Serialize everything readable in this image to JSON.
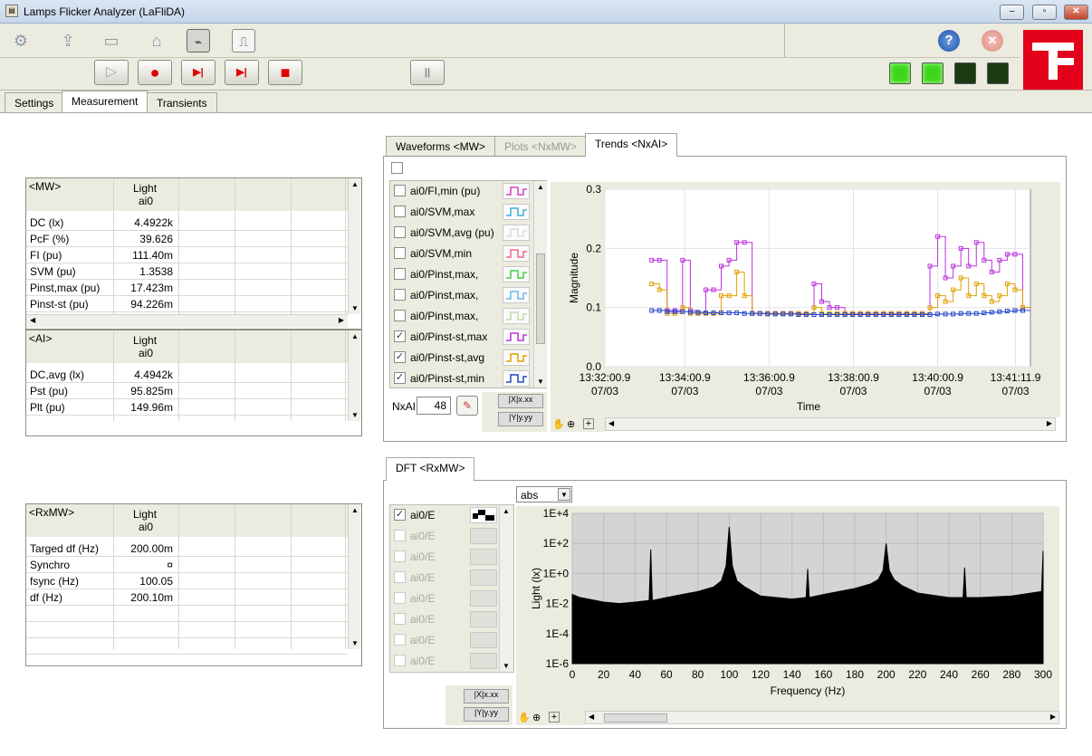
{
  "window": {
    "title": "Lamps Flicker Analyzer (LaFliDA)",
    "minimize": "‒",
    "maximize": "▫",
    "close": "✕"
  },
  "toolbar": {
    "icons": [
      "gear-icon",
      "export-icon",
      "folder-icon",
      "home-icon",
      "monitor-icon",
      "chart-icon"
    ],
    "help": "?",
    "stop": "✕",
    "controls": {
      "play": "▷",
      "record": "●",
      "step": "▶|",
      "step_one": "▶|",
      "stop": "■",
      "pause": "||"
    },
    "leds": [
      "#3ed61b",
      "#3ed61b",
      "#1c3a12",
      "#1c3a12"
    ]
  },
  "main_tabs": [
    "Settings",
    "Measurement",
    "Transients"
  ],
  "mw_table": {
    "title": "<MW>",
    "col_header": "Light",
    "col_sub": "ai0",
    "rows": [
      {
        "k": "DC (lx)",
        "v": "4.4922k"
      },
      {
        "k": "PcF (%)",
        "v": "39.626"
      },
      {
        "k": "FI (pu)",
        "v": "111.40m"
      },
      {
        "k": "SVM (pu)",
        "v": "1.3538"
      },
      {
        "k": "Pinst,max (pu)",
        "v": "17.423m"
      },
      {
        "k": "Pinst-st (pu)",
        "v": "94.226m"
      }
    ]
  },
  "ai_table": {
    "title": "<AI>",
    "col_header": "Light",
    "col_sub": "ai0",
    "rows": [
      {
        "k": "DC,avg (lx)",
        "v": "4.4942k"
      },
      {
        "k": "Pst (pu)",
        "v": "95.825m"
      },
      {
        "k": "Plt (pu)",
        "v": "149.96m"
      }
    ]
  },
  "rxmw_table": {
    "title": "<RxMW>",
    "col_header": "Light",
    "col_sub": "ai0",
    "rows": [
      {
        "k": "Targed df (Hz)",
        "v": "200.00m"
      },
      {
        "k": "Synchro",
        "v": "¤"
      },
      {
        "k": "fsync (Hz)",
        "v": "100.05"
      },
      {
        "k": "df (Hz)",
        "v": "200.10m"
      }
    ]
  },
  "graph_tabs": [
    "Waveforms <MW>",
    "Plots <NxMW>",
    "Trends <NxAI>"
  ],
  "trend_legend": [
    {
      "label": "ai0/FI,min (pu)",
      "checked": false,
      "color": "#cc44cc"
    },
    {
      "label": "ai0/SVM,max",
      "checked": false,
      "color": "#44aadd"
    },
    {
      "label": "ai0/SVM,avg (pu)",
      "checked": false,
      "color": "#dddddd"
    },
    {
      "label": "ai0/SVM,min",
      "checked": false,
      "color": "#ee6688"
    },
    {
      "label": "ai0/Pinst,max,",
      "checked": false,
      "color": "#44cc44"
    },
    {
      "label": "ai0/Pinst,max,",
      "checked": false,
      "color": "#66bbee"
    },
    {
      "label": "ai0/Pinst,max,",
      "checked": false,
      "color": "#bbddaa"
    },
    {
      "label": "ai0/Pinst-st,max",
      "checked": true,
      "color": "#bb33dd"
    },
    {
      "label": "ai0/Pinst-st,avg",
      "checked": true,
      "color": "#e0a000"
    },
    {
      "label": "ai0/Pinst-st,min",
      "checked": true,
      "color": "#2244cc"
    }
  ],
  "nxai": {
    "label": "NxAI",
    "value": "48"
  },
  "dft_tab": "DFT <RxMW>",
  "dft_select": "abs",
  "dft_legend": [
    {
      "label": "ai0/E",
      "checked": true,
      "enabled": true
    },
    {
      "label": "ai0/E",
      "checked": false,
      "enabled": false
    },
    {
      "label": "ai0/E",
      "checked": false,
      "enabled": false
    },
    {
      "label": "ai0/E",
      "checked": false,
      "enabled": false
    },
    {
      "label": "ai0/E",
      "checked": false,
      "enabled": false
    },
    {
      "label": "ai0/E",
      "checked": false,
      "enabled": false
    },
    {
      "label": "ai0/E",
      "checked": false,
      "enabled": false
    },
    {
      "label": "ai0/E",
      "checked": false,
      "enabled": false
    }
  ],
  "chart_data": [
    {
      "type": "line",
      "xlabel": "Time",
      "ylabel": "Magnitude",
      "ylim": [
        0,
        0.3
      ],
      "yticks": [
        "0.0",
        "0.1",
        "0.2",
        "0.3"
      ],
      "xticks": [
        [
          "13:32:00.9",
          "07/03"
        ],
        [
          "13:34:00.9",
          "07/03"
        ],
        [
          "13:36:00.9",
          "07/03"
        ],
        [
          "13:38:00.9",
          "07/03"
        ],
        [
          "13:40:00.9",
          "07/03"
        ],
        [
          "13:41:11.9",
          "07/03"
        ]
      ],
      "series": [
        {
          "name": "ai0/Pinst-st,max",
          "color": "#bb33dd",
          "values": [
            0.18,
            0.18,
            0.095,
            0.095,
            0.18,
            0.095,
            0.09,
            0.13,
            0.13,
            0.17,
            0.18,
            0.21,
            0.21,
            0.09,
            0.09,
            0.09,
            0.09,
            0.09,
            0.09,
            0.09,
            0.09,
            0.14,
            0.11,
            0.1,
            0.1,
            0.09,
            0.09,
            0.09,
            0.09,
            0.09,
            0.09,
            0.09,
            0.09,
            0.09,
            0.09,
            0.09,
            0.17,
            0.22,
            0.15,
            0.17,
            0.2,
            0.17,
            0.21,
            0.18,
            0.16,
            0.18,
            0.19,
            0.19,
            0.1
          ]
        },
        {
          "name": "ai0/Pinst-st,avg",
          "color": "#e0a000",
          "values": [
            0.14,
            0.13,
            0.09,
            0.09,
            0.1,
            0.09,
            0.09,
            0.09,
            0.09,
            0.12,
            0.12,
            0.16,
            0.12,
            0.09,
            0.09,
            0.09,
            0.09,
            0.09,
            0.09,
            0.09,
            0.09,
            0.1,
            0.09,
            0.09,
            0.09,
            0.09,
            0.09,
            0.09,
            0.09,
            0.09,
            0.09,
            0.09,
            0.09,
            0.09,
            0.09,
            0.09,
            0.1,
            0.12,
            0.11,
            0.13,
            0.15,
            0.12,
            0.14,
            0.12,
            0.11,
            0.12,
            0.14,
            0.13,
            0.1
          ]
        },
        {
          "name": "ai0/Pinst-st,min",
          "color": "#2244cc",
          "values": [
            0.095,
            0.095,
            0.093,
            0.093,
            0.093,
            0.092,
            0.092,
            0.091,
            0.091,
            0.091,
            0.091,
            0.091,
            0.09,
            0.09,
            0.09,
            0.089,
            0.089,
            0.089,
            0.089,
            0.088,
            0.088,
            0.088,
            0.088,
            0.088,
            0.088,
            0.088,
            0.088,
            0.088,
            0.088,
            0.088,
            0.088,
            0.088,
            0.088,
            0.088,
            0.088,
            0.088,
            0.088,
            0.089,
            0.089,
            0.089,
            0.09,
            0.09,
            0.09,
            0.091,
            0.092,
            0.093,
            0.094,
            0.095,
            0.095
          ]
        }
      ]
    },
    {
      "type": "area",
      "xlabel": "Frequency (Hz)",
      "ylabel": "Light (lx)",
      "xlim": [
        0,
        300
      ],
      "ylim_log10": [
        -6,
        4
      ],
      "xticks": [
        "0",
        "20",
        "40",
        "60",
        "80",
        "100",
        "120",
        "140",
        "160",
        "180",
        "200",
        "220",
        "240",
        "260",
        "280",
        "300"
      ],
      "yticks": [
        "1E-6",
        "1E-4",
        "1E-2",
        "1E+0",
        "1E+2",
        "1E+4"
      ],
      "series": [
        {
          "name": "ai0/E",
          "x": [
            0,
            5,
            10,
            20,
            30,
            40,
            49,
            50,
            51,
            60,
            80,
            90,
            95,
            98,
            100,
            102,
            105,
            110,
            120,
            140,
            149,
            150,
            151,
            160,
            180,
            190,
            195,
            198,
            200,
            202,
            205,
            210,
            220,
            240,
            249,
            250,
            251,
            260,
            280,
            299,
            300
          ],
          "y_log10": [
            -1.4,
            -1.6,
            -1.7,
            -1.9,
            -2.0,
            -1.9,
            -1.8,
            1.6,
            -1.8,
            -1.6,
            -1.2,
            -0.9,
            -0.5,
            0.5,
            3.1,
            0.5,
            -0.5,
            -0.9,
            -1.5,
            -1.7,
            -1.6,
            0.3,
            -1.6,
            -1.4,
            -1.0,
            -0.7,
            -0.4,
            0.2,
            2.0,
            0.2,
            -0.4,
            -0.8,
            -1.3,
            -1.6,
            -1.6,
            0.4,
            -1.6,
            -1.6,
            -1.5,
            -1.2,
            1.5
          ]
        }
      ]
    }
  ]
}
